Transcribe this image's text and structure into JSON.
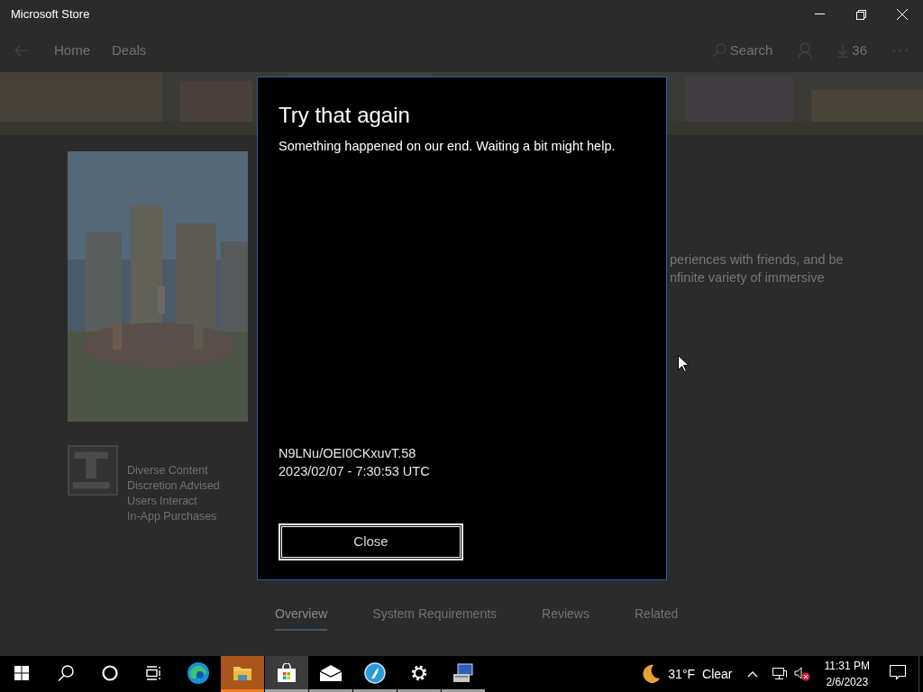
{
  "window": {
    "title": "Microsoft Store"
  },
  "nav": {
    "items": [
      {
        "label": "Home"
      },
      {
        "label": "Deals"
      }
    ],
    "search_label": "Search",
    "downloads_count": "36"
  },
  "product": {
    "ratings": [
      "Diverse Content",
      "Discretion Advised",
      "Users Interact",
      "In-App Purchases"
    ],
    "description_lines": [
      "periences with friends, and be",
      "nfinite variety of immersive"
    ],
    "tabs": [
      {
        "label": "Overview",
        "selected": true
      },
      {
        "label": "System Requirements",
        "selected": false
      },
      {
        "label": "Reviews",
        "selected": false
      },
      {
        "label": "Related",
        "selected": false
      }
    ]
  },
  "dialog": {
    "title": "Try that again",
    "message": "Something happened on our end. Waiting a bit might help.",
    "error_code": "N9LNu/OEI0CKxuvT.58",
    "timestamp": "2023/02/07 - 7:30:53 UTC",
    "button": "Close"
  },
  "taskbar": {
    "apps": [
      {
        "kind": "start"
      },
      {
        "kind": "search"
      },
      {
        "kind": "cortana"
      },
      {
        "kind": "taskview"
      },
      {
        "kind": "edge",
        "running": false,
        "selected": false,
        "flashing": false
      },
      {
        "kind": "explorer",
        "running": true,
        "selected": false,
        "flashing": true
      },
      {
        "kind": "store",
        "running": true,
        "selected": true,
        "flashing": false
      },
      {
        "kind": "mail",
        "running": true,
        "selected": false,
        "flashing": false
      },
      {
        "kind": "browser",
        "running": true,
        "selected": false,
        "flashing": false
      },
      {
        "kind": "settings",
        "running": true,
        "selected": false,
        "flashing": false
      },
      {
        "kind": "computer",
        "running": true,
        "selected": false,
        "flashing": false
      }
    ],
    "weather": {
      "temperature": "31°F",
      "condition": "Clear"
    },
    "clock": {
      "time": "11:31 PM",
      "date": "2/6/2023"
    }
  }
}
